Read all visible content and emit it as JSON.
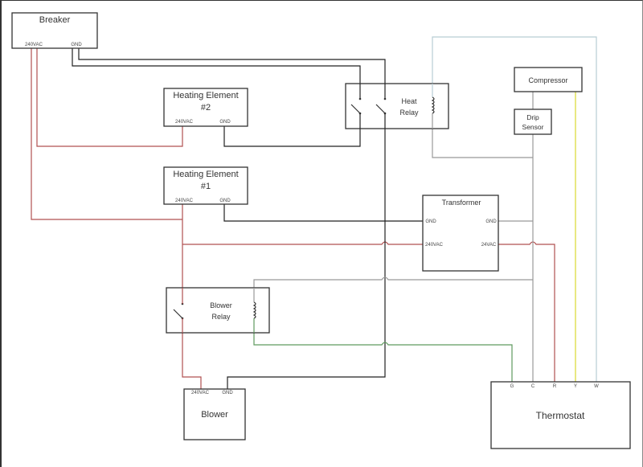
{
  "diagram": {
    "type": "wiring-schematic",
    "components": {
      "breaker": {
        "title": "Breaker",
        "pins": [
          "240VAC",
          "GND"
        ]
      },
      "heating_element_2": {
        "title_line1": "Heating Element",
        "title_line2": "#2",
        "pins": [
          "240VAC",
          "GND"
        ]
      },
      "heating_element_1": {
        "title_line1": "Heating Element",
        "title_line2": "#1",
        "pins": [
          "240VAC",
          "GND"
        ]
      },
      "heat_relay": {
        "title_line1": "Heat",
        "title_line2": "Relay"
      },
      "compressor": {
        "title": "Compressor"
      },
      "drip_sensor": {
        "title_line1": "Drip",
        "title_line2": "Sensor"
      },
      "transformer": {
        "title": "Transformer",
        "pins": [
          "GND",
          "240VAC",
          "GND",
          "24VAC"
        ]
      },
      "blower_relay": {
        "title_line1": "Blower",
        "title_line2": "Relay"
      },
      "blower": {
        "title": "Blower",
        "pins": [
          "240VAC",
          "GND"
        ]
      },
      "thermostat": {
        "title": "Thermostat",
        "terminals": [
          "G",
          "C",
          "R",
          "Y",
          "W"
        ]
      }
    },
    "wire_colors": {
      "ground": "#222222",
      "line_240vac": "#b05050",
      "common_24v": "#999999",
      "fan_g": "#5f9a5f",
      "cool_y": "#d8d830",
      "heat_w": "#b8cdd4"
    },
    "connections": [
      {
        "from": "Breaker 240VAC",
        "to": "Heating Element #2 240VAC",
        "color": "line_240vac"
      },
      {
        "from": "Breaker 240VAC",
        "to": "Heating Element #1 240VAC",
        "color": "line_240vac"
      },
      {
        "from": "Heating Element #1 240VAC",
        "to": "Transformer 240VAC",
        "color": "line_240vac"
      },
      {
        "from": "Heating Element #1 240VAC",
        "to": "Blower Relay switch",
        "color": "line_240vac"
      },
      {
        "from": "Blower Relay switch",
        "to": "Blower 240VAC",
        "color": "line_240vac"
      },
      {
        "from": "Breaker GND",
        "to": "Heat Relay switches",
        "color": "ground"
      },
      {
        "from": "Heat Relay switch",
        "to": "Heating Element #2 GND",
        "color": "ground"
      },
      {
        "from": "Heat Relay switch",
        "to": "Blower GND",
        "color": "ground"
      },
      {
        "from": "Heating Element #1 GND",
        "to": "Transformer GND",
        "color": "ground"
      },
      {
        "from": "Transformer GND",
        "to": "Thermostat C",
        "color": "common_24v"
      },
      {
        "from": "Transformer 24VAC",
        "to": "Thermostat R",
        "color": "line_240vac"
      },
      {
        "from": "Blower Relay coil",
        "to": "Thermostat C",
        "color": "common_24v"
      },
      {
        "from": "Blower Relay coil",
        "to": "Thermostat G",
        "color": "fan_g"
      },
      {
        "from": "Heat Relay coil",
        "to": "Drip Sensor / Thermostat C",
        "color": "common_24v"
      },
      {
        "from": "Compressor",
        "to": "Drip Sensor",
        "color": "common_24v"
      },
      {
        "from": "Compressor",
        "to": "Thermostat Y",
        "color": "cool_y"
      },
      {
        "from": "Heat Relay coil",
        "to": "Thermostat W",
        "color": "heat_w"
      }
    ]
  }
}
